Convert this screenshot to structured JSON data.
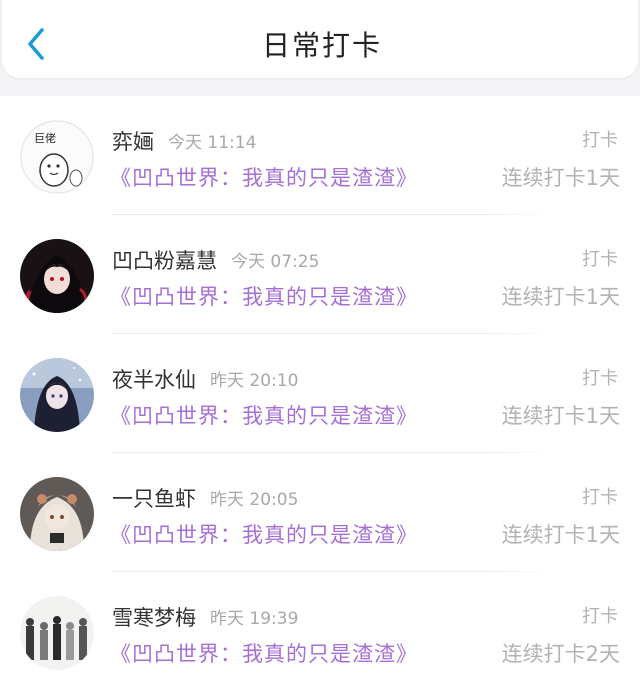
{
  "header": {
    "title": "日常打卡",
    "back_icon": "chevron-left-icon",
    "accent_color": "#1a9ad6"
  },
  "colors": {
    "book_title": "#a56fd6",
    "muted": "#b3b3b3",
    "name": "#333333"
  },
  "records": [
    {
      "name": "弈婳",
      "time": "今天 11:14",
      "book": "《凹凸世界：我真的只是渣渣》",
      "tag": "打卡",
      "streak": "连续打卡1天",
      "avatar_badge": "巨佬"
    },
    {
      "name": "凹凸粉嘉慧",
      "time": "今天 07:25",
      "book": "《凹凸世界：我真的只是渣渣》",
      "tag": "打卡",
      "streak": "连续打卡1天"
    },
    {
      "name": "夜半水仙",
      "time": "昨天 20:10",
      "book": "《凹凸世界：我真的只是渣渣》",
      "tag": "打卡",
      "streak": "连续打卡1天"
    },
    {
      "name": "一只鱼虾",
      "time": "昨天 20:05",
      "book": "《凹凸世界：我真的只是渣渣》",
      "tag": "打卡",
      "streak": "连续打卡1天"
    },
    {
      "name": "雪寒梦梅",
      "time": "昨天 19:39",
      "book": "《凹凸世界：我真的只是渣渣》",
      "tag": "打卡",
      "streak": "连续打卡2天"
    }
  ]
}
